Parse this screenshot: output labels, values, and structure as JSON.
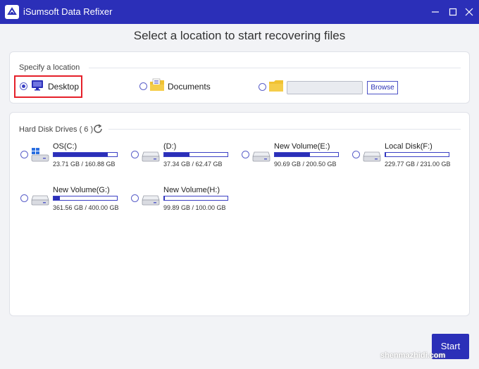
{
  "window": {
    "title": "iSumsoft Data Refixer"
  },
  "headline": "Select a location to start recovering files",
  "location": {
    "label": "Specify a location",
    "options": [
      {
        "label": "Desktop",
        "selected": true,
        "icon": "desktop-icon"
      },
      {
        "label": "Documents",
        "selected": false,
        "icon": "documents-folder-icon"
      },
      {
        "label": "",
        "selected": false,
        "icon": "folder-icon"
      }
    ],
    "path_value": "",
    "browse_label": "Browse"
  },
  "drives": {
    "label": "Hard Disk Drives ( 6 )",
    "items": [
      {
        "name": "OS(C:)",
        "size": "23.71 GB / 160.88 GB",
        "used_fraction": 0.85,
        "icon": "windows-drive-icon"
      },
      {
        "name": "(D:)",
        "size": "37.34 GB / 62.47 GB",
        "used_fraction": 0.4,
        "icon": "hard-drive-icon"
      },
      {
        "name": "New Volume(E:)",
        "size": "90.69 GB / 200.50 GB",
        "used_fraction": 0.55,
        "icon": "hard-drive-icon"
      },
      {
        "name": "Local Disk(F:)",
        "size": "229.77 GB / 231.00 GB",
        "used_fraction": 0.01,
        "icon": "hard-drive-icon"
      },
      {
        "name": "New Volume(G:)",
        "size": "361.56 GB / 400.00 GB",
        "used_fraction": 0.1,
        "icon": "hard-drive-icon"
      },
      {
        "name": "New Volume(H:)",
        "size": "99.89 GB / 100.00 GB",
        "used_fraction": 0.01,
        "icon": "hard-drive-icon"
      }
    ]
  },
  "start_label": "Start",
  "watermark": "shenmazhidi.com",
  "colors": {
    "accent": "#2b2fb8",
    "highlight": "#e5202a"
  }
}
